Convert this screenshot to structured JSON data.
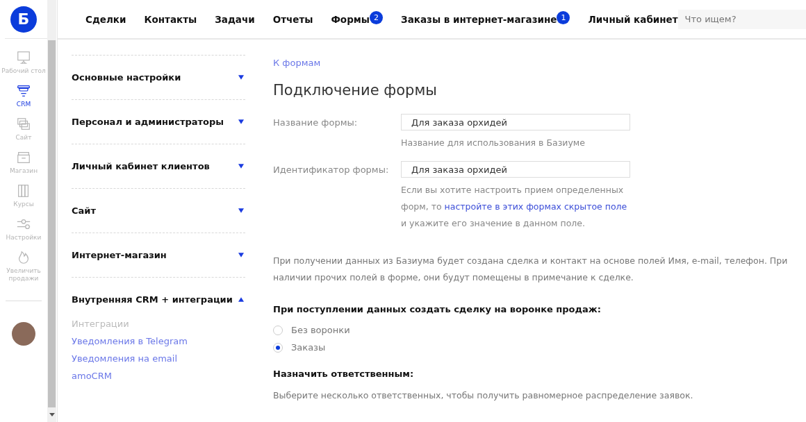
{
  "logo": {
    "letter": "Б"
  },
  "rail": [
    {
      "label": "Рабочий стол",
      "selected": false
    },
    {
      "label": "CRM",
      "selected": true
    },
    {
      "label": "Сайт",
      "selected": false
    },
    {
      "label": "Магазин",
      "selected": false
    },
    {
      "label": "Курсы",
      "selected": false
    },
    {
      "label": "Настройки",
      "selected": false
    },
    {
      "label": "Увеличить продажи",
      "selected": false
    }
  ],
  "nav": [
    {
      "label": "Сделки"
    },
    {
      "label": "Контакты"
    },
    {
      "label": "Задачи"
    },
    {
      "label": "Отчеты"
    },
    {
      "label": "Формы",
      "badge": "2"
    },
    {
      "label": "Заказы в интернет-магазине",
      "badge": "1"
    },
    {
      "label": "Личный кабинет"
    }
  ],
  "search": {
    "placeholder": "Что ищем?"
  },
  "settings_sections": [
    {
      "title": "Основные настройки",
      "expanded": false
    },
    {
      "title": "Персонал и администраторы",
      "expanded": false
    },
    {
      "title": "Личный кабинет клиентов",
      "expanded": false
    },
    {
      "title": "Сайт",
      "expanded": false
    },
    {
      "title": "Интернет-магазин",
      "expanded": false
    },
    {
      "title": "Внутренняя CRM + интеграции",
      "expanded": true,
      "items": [
        {
          "label": "Интеграции",
          "selected": true
        },
        {
          "label": "Уведомления в Telegram",
          "selected": false
        },
        {
          "label": "Уведомления на email",
          "selected": false
        },
        {
          "label": "amoCRM",
          "selected": false
        }
      ]
    }
  ],
  "back_link": "К формам",
  "title": "Подключение формы",
  "fields": [
    {
      "label": "Название формы:",
      "value": "Для заказа орхидей",
      "hint": "Название для использования в Базиуме"
    },
    {
      "label": "Идентификатор формы:",
      "value": "Для заказа орхидей",
      "hint_before": "Если вы хотите настроить прием определенных форм, то ",
      "hint_link": "настройте в этих формах скрытое поле",
      "hint_after": " и укажите его значение в данном поле."
    }
  ],
  "info": "При получении данных из Базиума будет создана сделка и контакт на основе полей Имя, e-mail, телефон. При наличии прочих полей в форме, они будут помещены в примечание к сделке.",
  "funnel": {
    "heading": "При поступлении данных создать сделку на воронке продаж:",
    "options": [
      {
        "label": "Без воронки",
        "selected": false
      },
      {
        "label": "Заказы",
        "selected": true
      }
    ]
  },
  "responsible": {
    "heading": "Назначить ответственным:",
    "text": "Выберите несколько ответственных, чтобы получить равномерное распределение заявок."
  }
}
